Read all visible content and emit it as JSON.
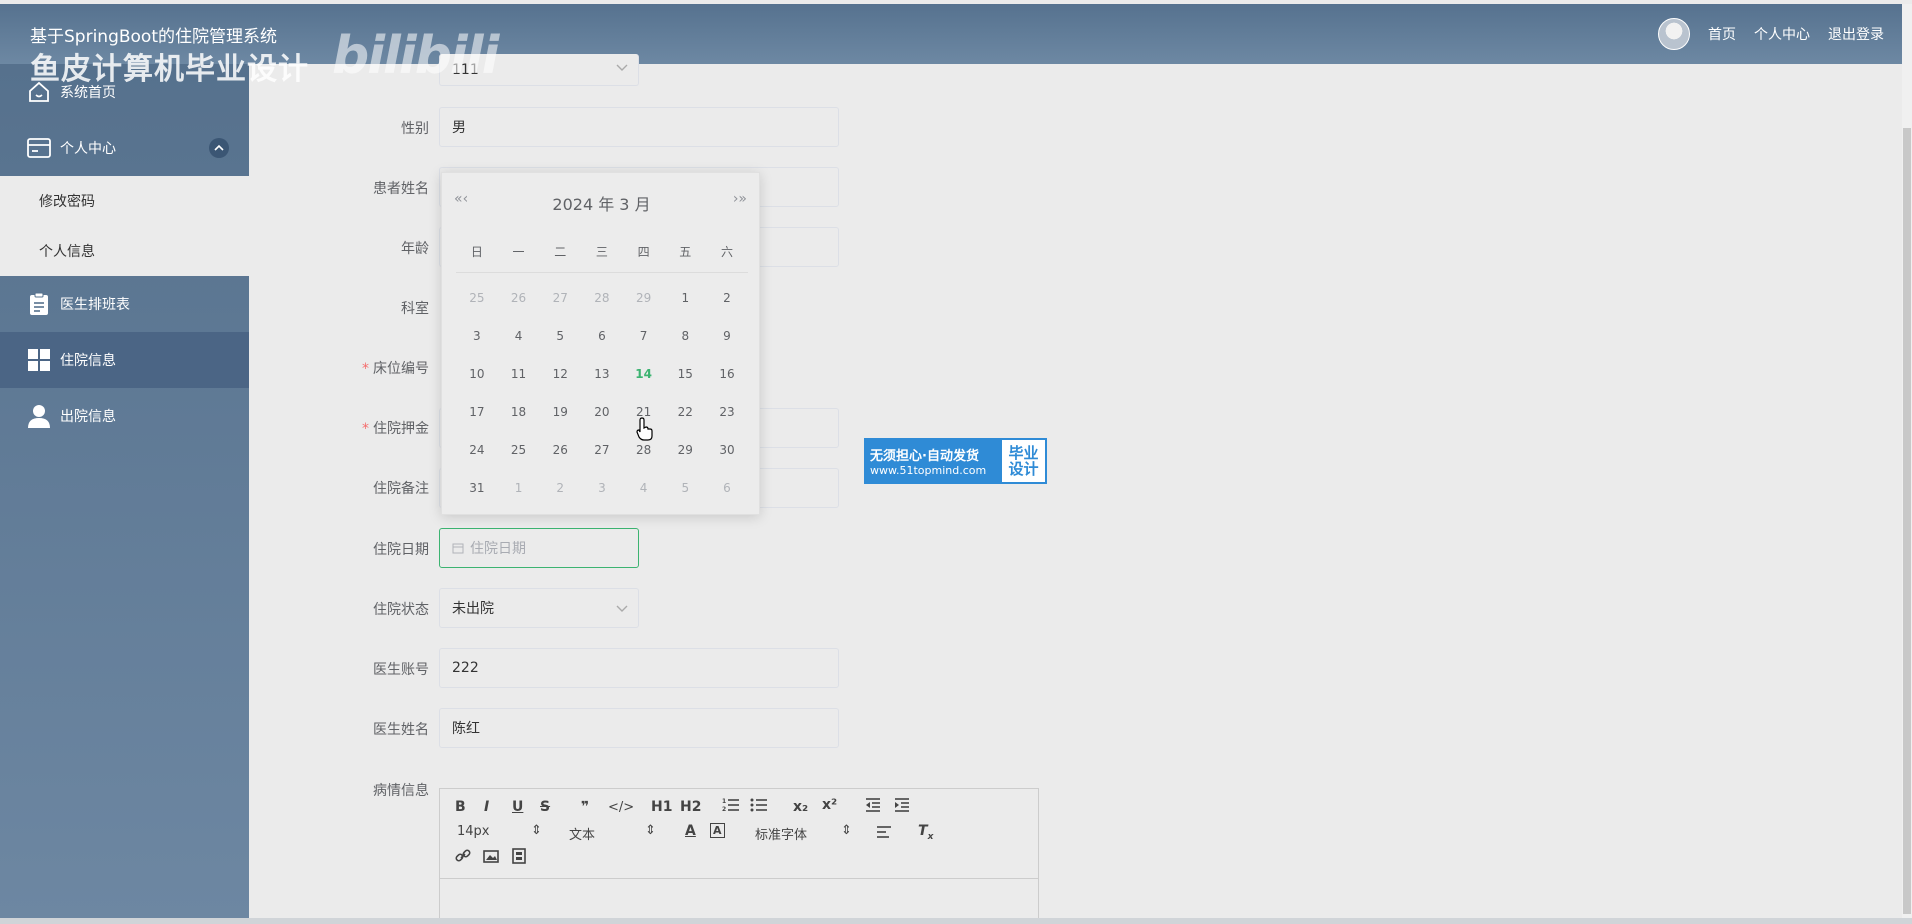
{
  "header": {
    "app_title": "基于SpringBoot的住院管理系统",
    "watermark_text": "鱼皮计算机毕业设计",
    "watermark_logo": "bilibili",
    "links": [
      "首页",
      "个人中心",
      "退出登录"
    ]
  },
  "sidebar": {
    "items": [
      {
        "label": "系统首页",
        "icon": "home-icon"
      },
      {
        "label": "个人中心",
        "icon": "card-icon"
      },
      {
        "label": "修改密码"
      },
      {
        "label": "个人信息"
      },
      {
        "label": "医生排班表",
        "icon": "clipboard-icon"
      },
      {
        "label": "住院信息",
        "icon": "grid-icon"
      },
      {
        "label": "出院信息",
        "icon": "user-icon"
      }
    ]
  },
  "form": {
    "top_value": "111",
    "fields": {
      "gender": {
        "label": "性别",
        "value": "男"
      },
      "patient_name": {
        "label": "患者姓名"
      },
      "age": {
        "label": "年龄"
      },
      "department": {
        "label": "科室"
      },
      "bed_no": {
        "label": "床位编号",
        "required": "*"
      },
      "deposit": {
        "label": "住院押金",
        "required": "*"
      },
      "remark": {
        "label": "住院备注"
      },
      "admit_date": {
        "label": "住院日期",
        "placeholder": "住院日期"
      },
      "status": {
        "label": "住院状态",
        "value": "未出院"
      },
      "doctor_account": {
        "label": "医生账号",
        "value": "222"
      },
      "doctor_name": {
        "label": "医生姓名",
        "value": "陈红"
      },
      "condition": {
        "label": "病情信息"
      }
    }
  },
  "editor": {
    "buttons": [
      "B",
      "I",
      "U",
      "S",
      "❞",
      "</>",
      "H1",
      "H2",
      "ol",
      "ul",
      "x₂",
      "x²",
      "outdent",
      "indent"
    ],
    "size": "14px",
    "format": "文本",
    "font": "标准字体"
  },
  "calendar": {
    "year_month": "2024 年  3 月",
    "nav_prev": "«‹",
    "nav_next": "›»",
    "weekdays": [
      "日",
      "一",
      "二",
      "三",
      "四",
      "五",
      "六"
    ],
    "weeks": [
      [
        "25",
        "26",
        "27",
        "28",
        "29",
        "1",
        "2"
      ],
      [
        "3",
        "4",
        "5",
        "6",
        "7",
        "8",
        "9"
      ],
      [
        "10",
        "11",
        "12",
        "13",
        "14",
        "15",
        "16"
      ],
      [
        "17",
        "18",
        "19",
        "20",
        "21",
        "22",
        "23"
      ],
      [
        "24",
        "25",
        "26",
        "27",
        "28",
        "29",
        "30"
      ],
      [
        "31",
        "1",
        "2",
        "3",
        "4",
        "5",
        "6"
      ]
    ],
    "today": "14"
  },
  "ad": {
    "line1": "无须担心·自动发货",
    "line2": "www.51topmind.com",
    "right": "毕业设计"
  },
  "colors": {
    "header": "#56728f",
    "sidebar_active": "#4b6585",
    "accent_green": "#3cb371",
    "required": "#f56c6c"
  }
}
